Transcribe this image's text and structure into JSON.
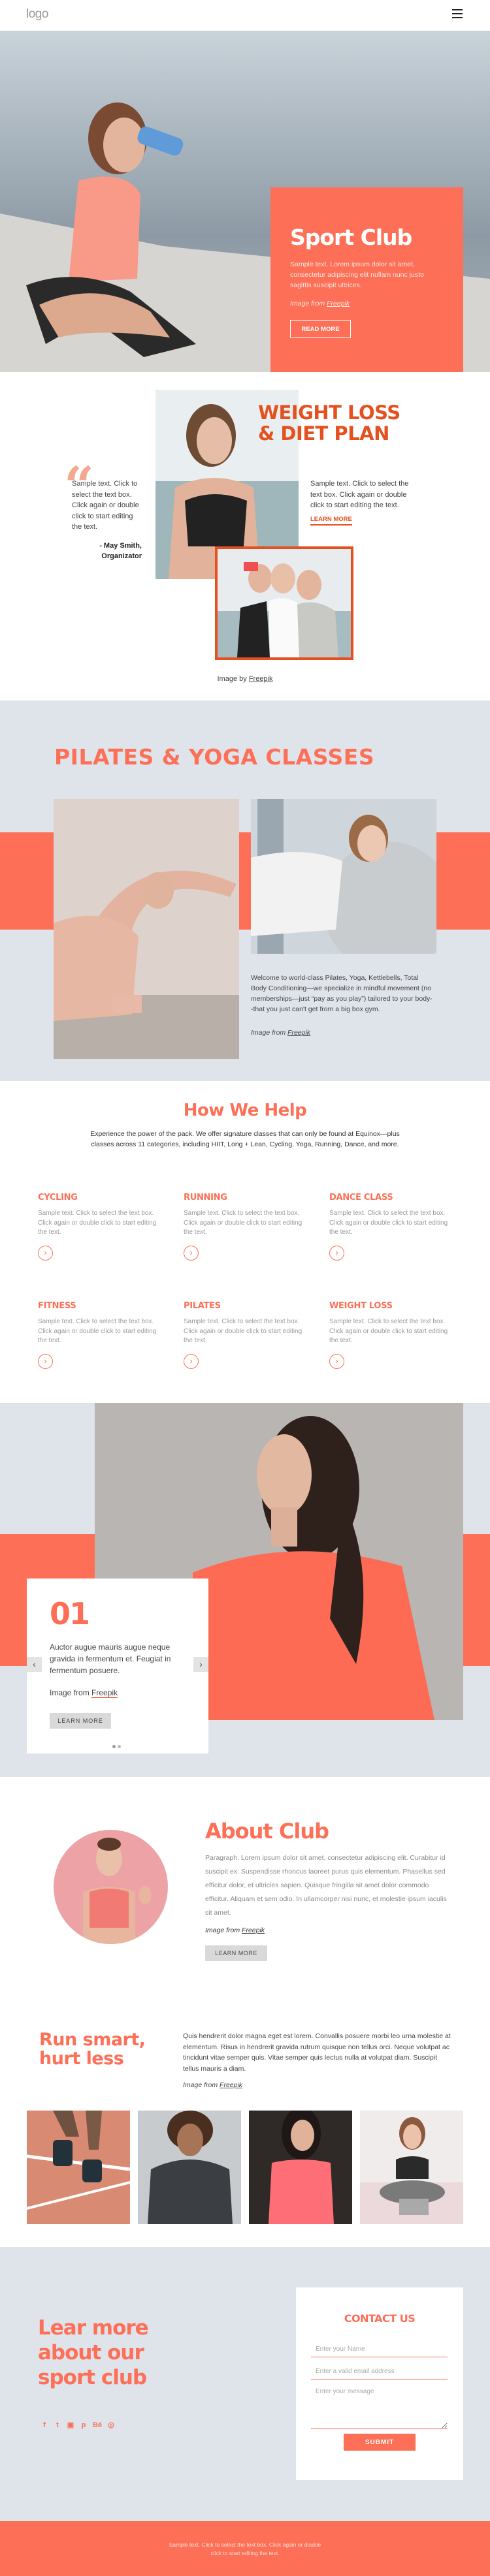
{
  "header": {
    "logo": "logo",
    "menu_icon": "hamburger-menu-icon"
  },
  "hero": {
    "title": "Sport Club",
    "text": "Sample text. Lorem ipsum dolor sit amet, consectetur adipiscing elit nullam nunc justo sagittis suscipit ultrices.",
    "credit_prefix": "Image from",
    "credit_link": "Freepik",
    "button": "READ MORE",
    "photo_alt": "woman drinking water by the sea"
  },
  "weight_loss": {
    "title_line1": "WEIGHT LOSS",
    "title_line2": "& DIET PLAN",
    "quote_mark": "“",
    "quote": "Sample text. Click to select the text box. Click again or double click to start editing the text.",
    "author_line1": "- May Smith,",
    "author_line2": "Organizator",
    "text": "Sample text. Click to select the text box. Click again or double click to start editing the text.",
    "learn_more": "LEARN MORE",
    "caption_prefix": "Image by",
    "caption_link": "Freepik"
  },
  "pilates": {
    "title": "PILATES & YOGA CLASSES",
    "text": "Welcome to world-class Pilates, Yoga, Kettlebells, Total Body Conditioning—we specialize in mindful movement (no memberships—just “pay as you play”) tailored to your body--that you just can't get from a big box gym.",
    "credit_prefix": "Image from",
    "credit_link": "Freepik"
  },
  "help": {
    "title": "How We Help",
    "intro": "Experience the power of the pack. We offer signature classes that can only be found at Equinox—plus classes across 11 categories, including HIIT, Long + Lean, Cycling, Yoga, Running, Dance, and more.",
    "items": [
      {
        "title": "CYCLING",
        "text": "Sample text. Click to select the text box. Click again or double click to start editing the text."
      },
      {
        "title": "RUNNING",
        "text": "Sample text. Click to select the text box. Click again or double click to start editing the text."
      },
      {
        "title": "DANCE CLASS",
        "text": "Sample text. Click to select the text box. Click again or double click to start editing the text."
      },
      {
        "title": "FITNESS",
        "text": "Sample text. Click to select the text box. Click again or double click to start editing the text."
      },
      {
        "title": "PILATES",
        "text": "Sample text. Click to select the text box. Click again or double click to start editing the text."
      },
      {
        "title": "WEIGHT LOSS",
        "text": "Sample text. Click to select the text box. Click again or double click to start editing the text."
      }
    ],
    "arrow_icon": "›"
  },
  "slider": {
    "number": "01",
    "text": "Auctor augue mauris augue neque gravida in fermentum et. Feugiat in fermentum posuere.",
    "credit_prefix": "Image from",
    "credit_link": "Freepik",
    "button": "LEARN MORE",
    "prev": "‹",
    "next": "›",
    "slide_count": 2,
    "active_slide": 1
  },
  "about": {
    "title": "About Club",
    "text": "Paragraph. Lorem ipsum dolor sit amet, consectetur adipiscing elit. Curabitur id suscipit ex. Suspendisse rhoncus laoreet purus quis elementum. Phasellus sed efficitur dolor, et ultricies sapien. Quisque fringilla sit amet dolor commodo efficitur. Aliquam et sem odio. In ullamcorper nisi nunc, et molestie ipsum iaculis sit amet.",
    "credit_prefix": "Image from",
    "credit_link": "Freepik",
    "button": "LEARN MORE"
  },
  "run": {
    "title_line1": "Run smart,",
    "title_line2": "hurt less",
    "text": "Quis hendrerit dolor magna eget est lorem. Convallis posuere morbi leo urna molestie at elementum. Risus in hendrerit gravida rutrum quisque non tellus orci. Neque volutpat ac tincidunt vitae semper quis. Vitae semper quis lectus nulla at volutpat diam. Suscipit tellus mauris a diam.",
    "credit_prefix": "Image from",
    "credit_link": "Freepik"
  },
  "contact": {
    "headline_line1": "Lear more",
    "headline_line2": "about our",
    "headline_line3": "sport club",
    "socials": [
      {
        "name": "facebook-icon",
        "glyph": "f"
      },
      {
        "name": "twitter-icon",
        "glyph": "t"
      },
      {
        "name": "instagram-icon",
        "glyph": "▣"
      },
      {
        "name": "pinterest-icon",
        "glyph": "p"
      },
      {
        "name": "behance-icon",
        "glyph": "Bé"
      },
      {
        "name": "dribbble-icon",
        "glyph": "◎"
      }
    ],
    "form_title": "CONTACT US",
    "name_placeholder": "Enter your Name",
    "email_placeholder": "Enter a valid email address",
    "message_placeholder": "Enter your message",
    "name_value": "",
    "email_value": "",
    "message_value": "",
    "submit": "SUBMIT"
  },
  "footer": {
    "text": "Sample text. Click to select the text box. Click again or double click to start editing the text."
  },
  "colors": {
    "accent": "#fd7057",
    "accent_dark": "#e5501f",
    "section_gray": "#dfe3ea"
  }
}
